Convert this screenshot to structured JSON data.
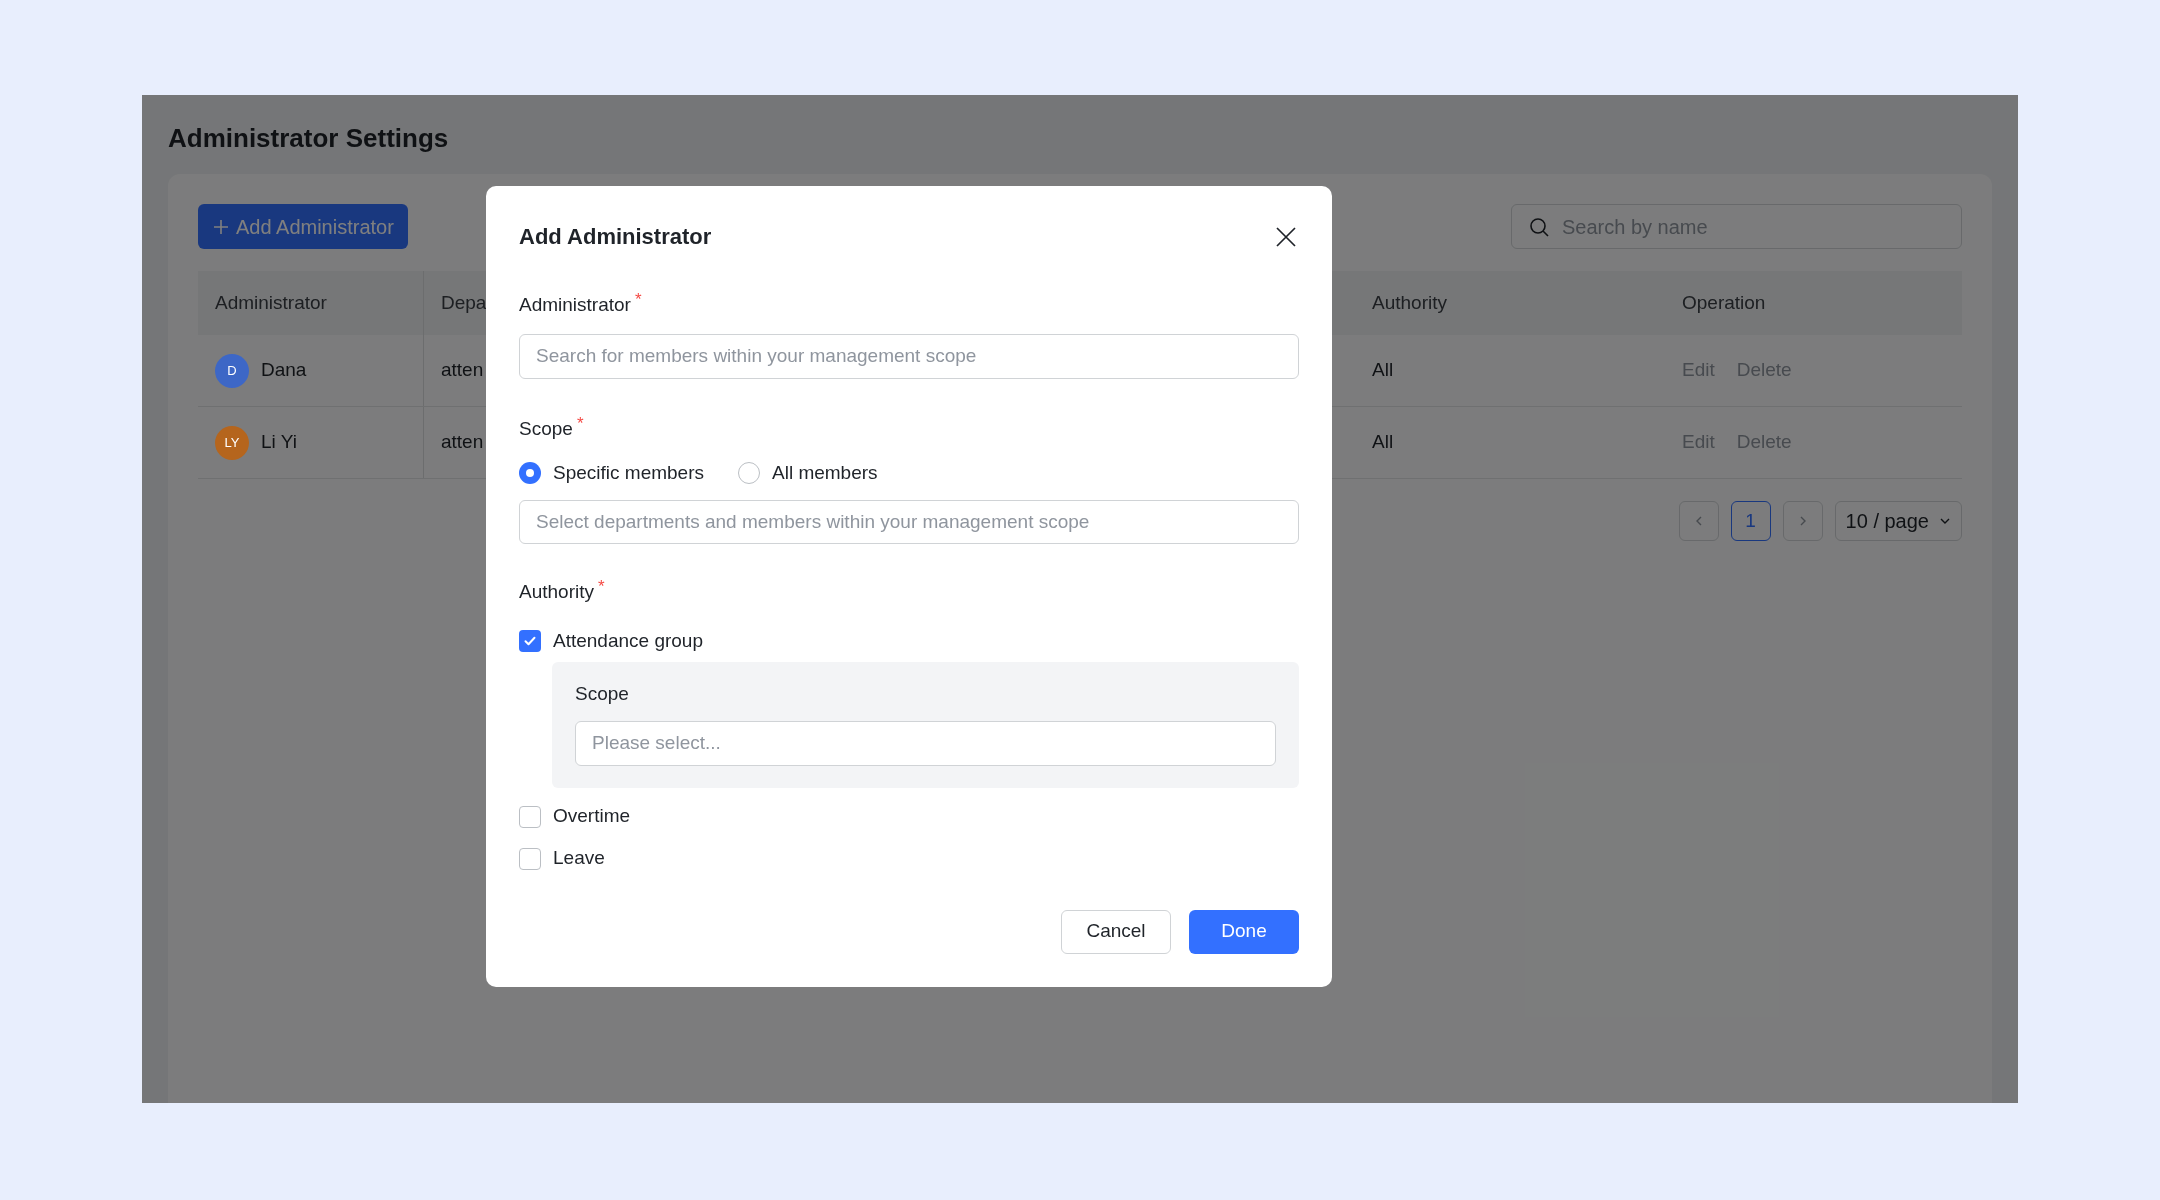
{
  "page": {
    "title": "Administrator Settings"
  },
  "toolbar": {
    "add_button": "Add Administrator",
    "search": {
      "placeholder": "Search by name"
    }
  },
  "table": {
    "columns": [
      "Administrator",
      "Depa",
      "Authority",
      "Operation"
    ],
    "rows": [
      {
        "avatar": "D",
        "color": "#3d67c6",
        "name": "Dana",
        "department": "atten",
        "authority": "All",
        "actions": [
          "Edit",
          "Delete"
        ]
      },
      {
        "avatar": "LY",
        "color": "#b5651d",
        "name": "Li Yi",
        "department": "atten",
        "authority": "All",
        "actions": [
          "Edit",
          "Delete"
        ]
      }
    ]
  },
  "pagination": {
    "pages": [
      {
        "label": "1",
        "selected": true
      }
    ],
    "page_size": "10 / page"
  },
  "dialog": {
    "title": "Add Administrator",
    "administrator": {
      "label": "Administrator",
      "required_mark": "*",
      "placeholder": "Search for members within your management scope"
    },
    "scope": {
      "label": "Scope",
      "required_mark": "*",
      "options": [
        {
          "label": "Specific members",
          "selected": true
        },
        {
          "label": "All members",
          "selected": false
        }
      ],
      "placeholder": "Select departments and members within your management scope"
    },
    "authority": {
      "label": "Authority",
      "required_mark": "*",
      "items": [
        {
          "label": "Attendance group",
          "checked": true,
          "scope": {
            "label": "Scope",
            "placeholder": "Please select..."
          }
        },
        {
          "label": "Overtime",
          "checked": false
        },
        {
          "label": "Leave",
          "checked": false
        }
      ]
    },
    "buttons": [
      {
        "label": "Cancel",
        "kind": "secondary"
      },
      {
        "label": "Done",
        "kind": "primary"
      }
    ]
  }
}
